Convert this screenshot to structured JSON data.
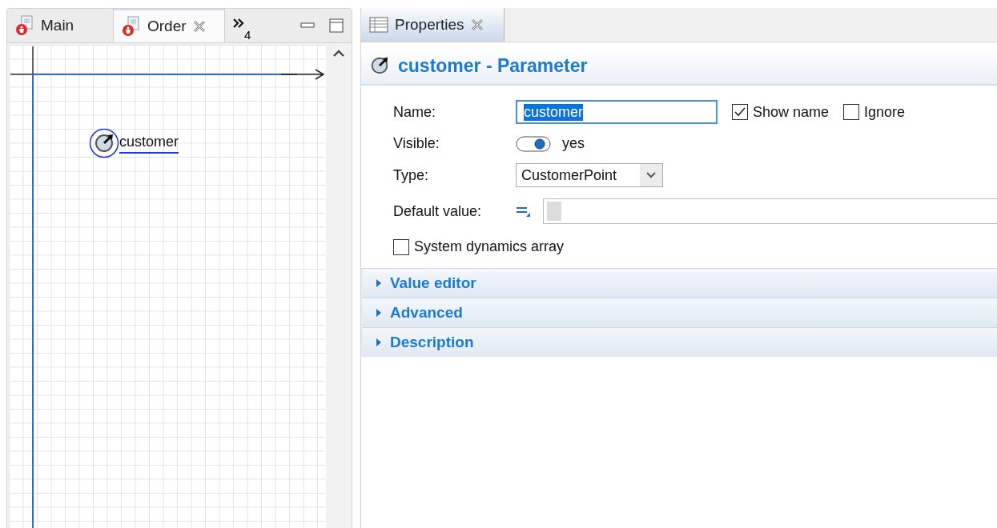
{
  "editor_tabs": [
    {
      "label": "Main",
      "selected": false
    },
    {
      "label": "Order",
      "selected": true
    }
  ],
  "editor_overflow": {
    "count": "4"
  },
  "diagram": {
    "parameter": {
      "label": "customer",
      "selected": true
    }
  },
  "properties_tab": {
    "label": "Properties",
    "selected": true
  },
  "header": {
    "title": "customer - Parameter"
  },
  "form": {
    "name_label": "Name:",
    "name_value": "customer",
    "show_name": {
      "label": "Show name",
      "checked": true
    },
    "ignore": {
      "label": "Ignore",
      "checked": false
    },
    "visible_label": "Visible:",
    "visible": {
      "on": true,
      "text": "yes"
    },
    "type_label": "Type:",
    "type_value": "CustomerPoint",
    "default_label": "Default value:",
    "sd_array": {
      "label": "System dynamics array",
      "checked": false
    }
  },
  "sections": [
    {
      "label": "Value editor",
      "expanded": false
    },
    {
      "label": "Advanced",
      "expanded": false
    },
    {
      "label": "Description",
      "expanded": false
    }
  ]
}
